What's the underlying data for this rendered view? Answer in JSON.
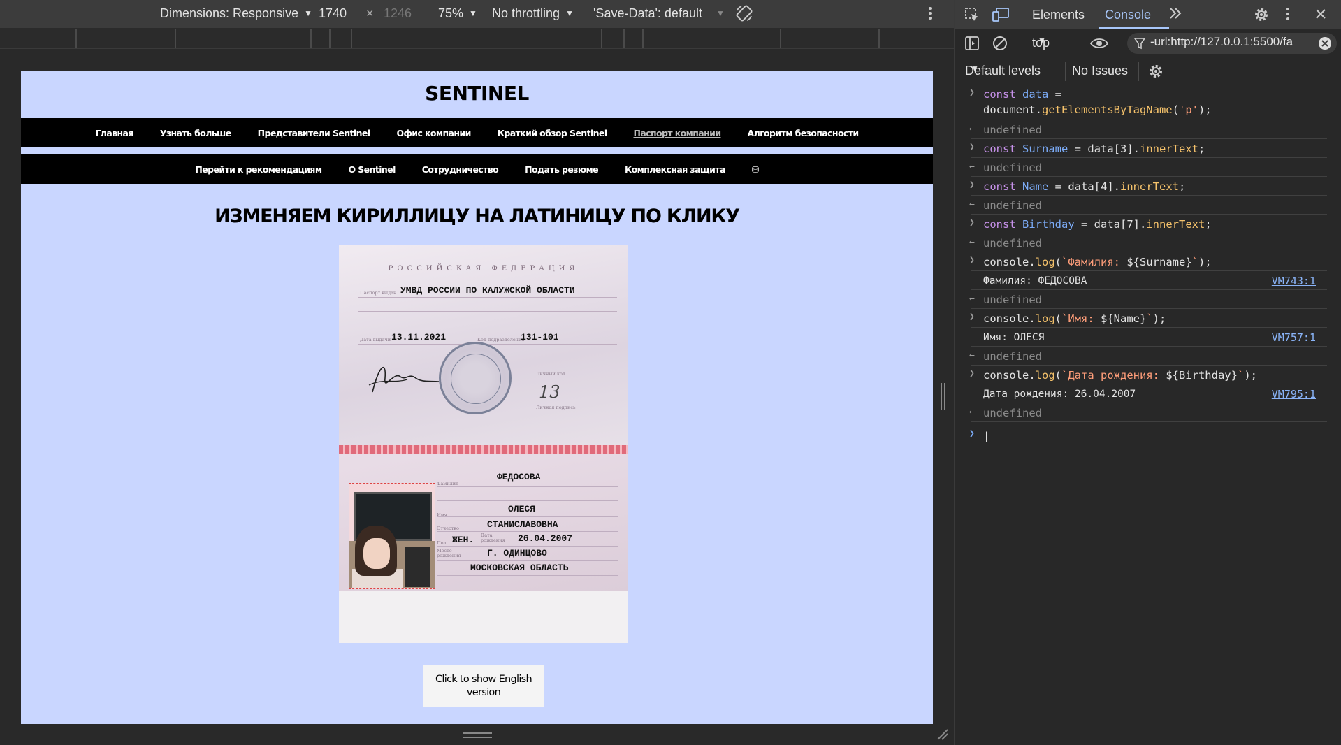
{
  "device_toolbar": {
    "dimensions_label": "Dimensions: Responsive",
    "width": "1740",
    "times": "×",
    "height": "1246",
    "zoom": "75%",
    "throttling": "No throttling",
    "save_data": "'Save-Data': default"
  },
  "page": {
    "site_title": "SENTINEL",
    "nav_primary": [
      "Главная",
      "Узнать больше",
      "Представители Sentinel",
      "Офис компании",
      "Краткий обзор Sentinel",
      "Паспорт компании",
      "Алгоритм безопасности"
    ],
    "nav_primary_active": 5,
    "nav_secondary": [
      "Перейти к рекомендациям",
      "О Sentinel",
      "Сотрудничество",
      "Подать резюме",
      "Комплексная защита",
      "⛁"
    ],
    "heading": "ИЗМЕНЯЕМ КИРИЛЛИЦУ НА ЛАТИНИЦУ ПО КЛИКУ",
    "passport": {
      "country": "РОССИЙСКАЯ ФЕДЕРАЦИЯ",
      "issued_by_label": "Паспорт выдан",
      "issued_by": "УМВД РОССИИ ПО КАЛУЖСКОЙ ОБЛАСТИ",
      "issue_date_label": "Дата выдачи",
      "issue_date": "13.11.2021",
      "division_code_label": "Код подразделения",
      "division_code": "131-101",
      "personal_code_label": "Личный код",
      "personal_signature_label": "Личная подпись",
      "personal_code": "13",
      "surname_label": "Фамилия",
      "surname": "ФЕДОСОВА",
      "name_label": "Имя",
      "name": "ОЛЕСЯ",
      "patronymic_label": "Отчество",
      "patronymic": "СТАНИСЛАВОВНА",
      "sex_label": "Пол",
      "sex": "ЖЕН.",
      "birth_date_label": "Дата рождения",
      "birth_date": "26.04.2007",
      "birth_place_label": "Место рождения",
      "birth_place_1": "Г. ОДИНЦОВО",
      "birth_place_2": "МОСКОВСКАЯ ОБЛАСТЬ"
    },
    "show_english_button": "Click to show English version"
  },
  "devtools": {
    "tabs": [
      "Elements",
      "Console"
    ],
    "active_tab": "Console",
    "context": "top",
    "filter_value": "-url:http://127.0.0.1:5500/fa",
    "levels": "Default levels",
    "issues": "No Issues",
    "console_entries": [
      {
        "kind": "input",
        "line1": "const data =",
        "line2": "document.getElementsByTagName('p');"
      },
      {
        "kind": "result",
        "text": "undefined"
      },
      {
        "kind": "input",
        "text": "const Surname = data[3].innerText;"
      },
      {
        "kind": "result",
        "text": "undefined"
      },
      {
        "kind": "input",
        "text": "const Name = data[4].innerText;"
      },
      {
        "kind": "result",
        "text": "undefined"
      },
      {
        "kind": "input",
        "text": "const Birthday = data[7].innerText;"
      },
      {
        "kind": "result",
        "text": "undefined"
      },
      {
        "kind": "input",
        "text": "console.log(`Фамилия: ${Surname}`);"
      },
      {
        "kind": "log",
        "text": "Фамилия: ФЕДОСОВА",
        "source": "VM743:1"
      },
      {
        "kind": "result",
        "text": "undefined"
      },
      {
        "kind": "input",
        "text": "console.log(`Имя: ${Name}`);"
      },
      {
        "kind": "log",
        "text": "Имя: ОЛЕСЯ",
        "source": "VM757:1"
      },
      {
        "kind": "result",
        "text": "undefined"
      },
      {
        "kind": "input",
        "text": "console.log(`Дата рождения: ${Birthday}`);"
      },
      {
        "kind": "log",
        "text": "Дата рождения: 26.04.2007",
        "source": "VM795:1"
      },
      {
        "kind": "result",
        "text": "undefined"
      }
    ]
  }
}
